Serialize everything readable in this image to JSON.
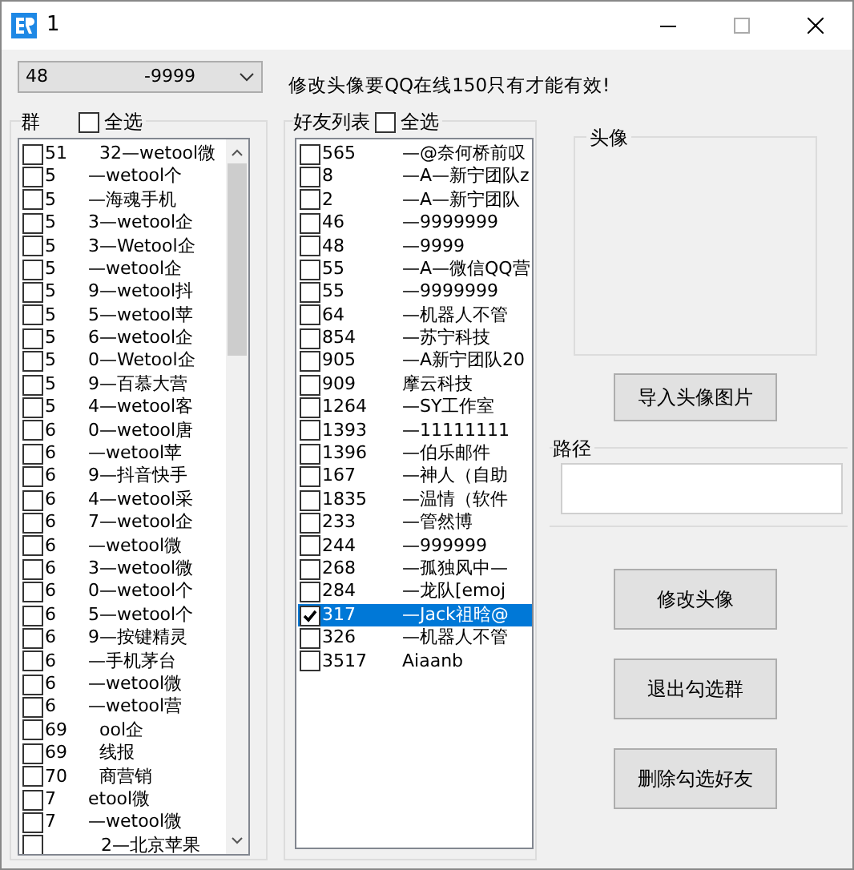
{
  "window": {
    "title": "1"
  },
  "account_select": {
    "value_start": "48",
    "value_end": "-9999"
  },
  "notice": "修改头像要QQ在线150只有才能有效!",
  "group_list": {
    "title": "群",
    "select_all": {
      "label": "全选",
      "checked": false
    },
    "items": [
      {
        "start": "51",
        "end": "32—wetool微",
        "checked": false
      },
      {
        "start": "5",
        "end": "—wetool个",
        "checked": false
      },
      {
        "start": "5",
        "end": "—海魂手机",
        "checked": false
      },
      {
        "start": "5",
        "end": "3—wetool企",
        "checked": false
      },
      {
        "start": "5",
        "end": "3—Wetool企",
        "checked": false
      },
      {
        "start": "5",
        "end": "—wetool企",
        "checked": false
      },
      {
        "start": "5",
        "end": "9—wetool抖",
        "checked": false
      },
      {
        "start": "5",
        "end": "5—wetool苹",
        "checked": false
      },
      {
        "start": "5",
        "end": "6—wetool企",
        "checked": false
      },
      {
        "start": "5",
        "end": "0—Wetool企",
        "checked": false
      },
      {
        "start": "5",
        "end": "9—百慕大营",
        "checked": false
      },
      {
        "start": "5",
        "end": "4—wetool客",
        "checked": false
      },
      {
        "start": "6",
        "end": "0—wetool唐",
        "checked": false
      },
      {
        "start": "6",
        "end": "—wetool苹",
        "checked": false
      },
      {
        "start": "6",
        "end": "9—抖音快手",
        "checked": false
      },
      {
        "start": "6",
        "end": "4—wetool采",
        "checked": false
      },
      {
        "start": "6",
        "end": "7—wetool企",
        "checked": false
      },
      {
        "start": "6",
        "end": "—wetool微",
        "checked": false
      },
      {
        "start": "6",
        "end": "3—wetool微",
        "checked": false
      },
      {
        "start": "6",
        "end": "0—wetool个",
        "checked": false
      },
      {
        "start": "6",
        "end": "5—wetool个",
        "checked": false
      },
      {
        "start": "6",
        "end": "9—按键精灵",
        "checked": false
      },
      {
        "start": "6",
        "end": "—手机茅台",
        "checked": false
      },
      {
        "start": "6",
        "end": "—wetool微",
        "checked": false
      },
      {
        "start": "6",
        "end": "—wetool营",
        "checked": false
      },
      {
        "start": "69",
        "end": "ool企",
        "checked": false
      },
      {
        "start": "69",
        "end": "线报",
        "checked": false
      },
      {
        "start": "70",
        "end": "商营销",
        "checked": false
      },
      {
        "start": "7",
        "end": "etool微",
        "checked": false
      },
      {
        "start": "7",
        "end": "—wetool微",
        "checked": false
      },
      {
        "end": "2—北京苹果",
        "checked": false
      }
    ]
  },
  "friend_list": {
    "title": "好友列表",
    "select_all": {
      "label": "全选",
      "checked": false
    },
    "items": [
      {
        "start": "565",
        "end": "—@奈何桥前叹",
        "checked": false,
        "selected": false
      },
      {
        "start": "8",
        "end": "—A—新宁团队z",
        "checked": false,
        "selected": false
      },
      {
        "start": "2",
        "end": "—A—新宁团队",
        "checked": false,
        "selected": false
      },
      {
        "start": "46",
        "end": "—9999999",
        "checked": false,
        "selected": false
      },
      {
        "start": "48",
        "end": "—9999",
        "checked": false,
        "selected": false
      },
      {
        "start": "55",
        "end": "—A—微信QQ营",
        "checked": false,
        "selected": false
      },
      {
        "start": "55",
        "end": "—9999999",
        "checked": false,
        "selected": false
      },
      {
        "start": "64",
        "end": "—机器人不管",
        "checked": false,
        "selected": false
      },
      {
        "start": "854",
        "end": "—苏宁科技",
        "checked": false,
        "selected": false
      },
      {
        "start": "905",
        "end": "—A新宁团队20",
        "checked": false,
        "selected": false
      },
      {
        "start": "909",
        "end": "摩云科技",
        "checked": false,
        "selected": false
      },
      {
        "start": "1264",
        "end": "—SY工作室",
        "checked": false,
        "selected": false
      },
      {
        "start": "1393",
        "end": "—11111111",
        "checked": false,
        "selected": false
      },
      {
        "start": "1396",
        "end": "—伯乐邮件",
        "checked": false,
        "selected": false
      },
      {
        "start": "167",
        "end": "—神人（自助",
        "checked": false,
        "selected": false
      },
      {
        "start": "1835",
        "end": "—温情（软件",
        "checked": false,
        "selected": false
      },
      {
        "start": "233",
        "end": "—管然博",
        "checked": false,
        "selected": false
      },
      {
        "start": "244",
        "end": "—999999",
        "checked": false,
        "selected": false
      },
      {
        "start": "268",
        "end": "—孤独风中—",
        "checked": false,
        "selected": false
      },
      {
        "start": "284",
        "end": "—龙队[emoj",
        "checked": false,
        "selected": false
      },
      {
        "start": "317",
        "end": "—Jack祖晗@",
        "checked": true,
        "selected": true
      },
      {
        "start": "326",
        "end": "—机器人不管",
        "checked": false,
        "selected": false
      },
      {
        "start": "3517",
        "end": "Aiaanb",
        "checked": false,
        "selected": false
      }
    ]
  },
  "avatar_group": {
    "title": "头像"
  },
  "import_button": "导入头像图片",
  "path_group": {
    "title": "路径"
  },
  "buttons": [
    "修改头像",
    "退出勾选群",
    "删除勾选好友"
  ]
}
